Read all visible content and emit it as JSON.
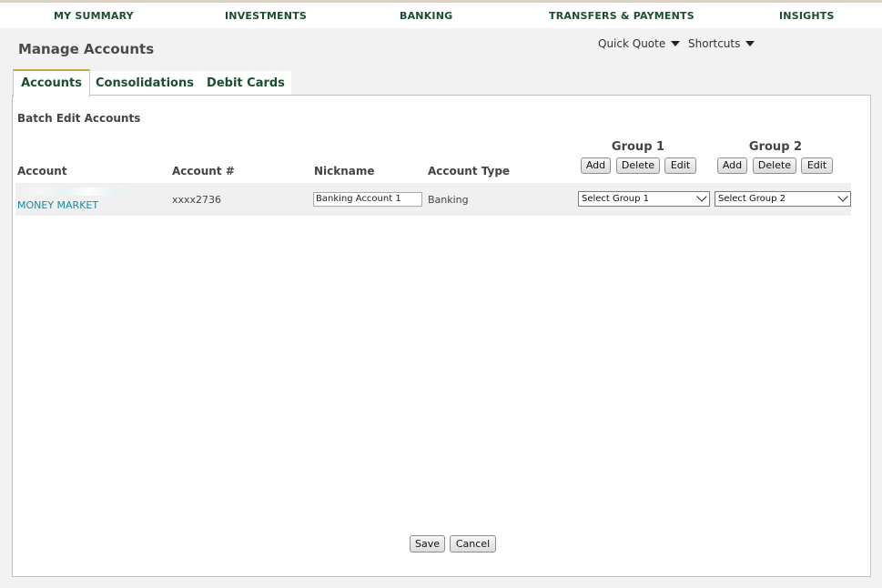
{
  "topnav": {
    "items": [
      "MY SUMMARY",
      "INVESTMENTS",
      "BANKING",
      "TRANSFERS & PAYMENTS",
      "INSIGHTS"
    ]
  },
  "header": {
    "title": "Manage Accounts",
    "quick_quote": "Quick Quote",
    "shortcuts": "Shortcuts"
  },
  "tabs": [
    {
      "label": "Accounts",
      "active": true
    },
    {
      "label": "Consolidations",
      "active": false
    },
    {
      "label": "Debit Cards",
      "active": false
    }
  ],
  "section": {
    "title": "Batch Edit Accounts"
  },
  "table": {
    "columns": {
      "account": "Account",
      "account_number": "Account #",
      "nickname": "Nickname",
      "account_type": "Account Type"
    },
    "group1": {
      "title": "Group 1",
      "add": "Add",
      "delete": "Delete",
      "edit": "Edit"
    },
    "group2": {
      "title": "Group 2",
      "add": "Add",
      "delete": "Delete",
      "edit": "Edit"
    },
    "rows": [
      {
        "account_line2": "MONEY MARKET",
        "account_number": "xxxx2736",
        "nickname": "Banking Account 1",
        "account_type": "Banking",
        "group1_selected": "Select Group 1",
        "group2_selected": "Select Group 2"
      }
    ]
  },
  "footer": {
    "save": "Save",
    "cancel": "Cancel"
  },
  "colors": {
    "nav_text": "#1b4d2f",
    "tab_accent": "#c8a84b",
    "link": "#1a8a9c",
    "backdrop": "#f2f2f2"
  }
}
